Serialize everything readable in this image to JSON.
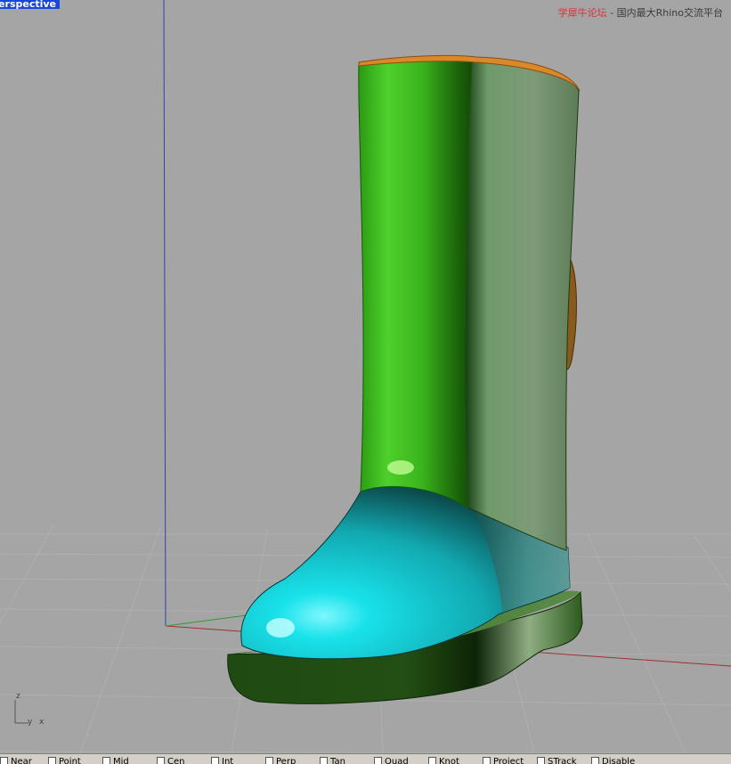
{
  "viewport": {
    "label": "Perspective",
    "watermark": {
      "primary": "学犀牛论坛",
      "separator": " - ",
      "secondary": "国内最大Rhino交流平台"
    },
    "axis_icon": {
      "z": "z",
      "y": "y",
      "x": "x"
    }
  },
  "colors": {
    "background": "#a5a5a5",
    "label_bg": "#1a46d8",
    "boot_shaft": "#3bb51c",
    "boot_toe": "#18c8cf",
    "boot_sole": "#1f4a12",
    "shaft_trim": "#c8781c"
  },
  "statusbar": {
    "snaps": [
      {
        "label": "Near"
      },
      {
        "label": "Point"
      },
      {
        "label": "Mid"
      },
      {
        "label": "Cen"
      },
      {
        "label": "Int"
      },
      {
        "label": "Perp"
      },
      {
        "label": "Tan"
      },
      {
        "label": "Quad"
      },
      {
        "label": "Knot"
      },
      {
        "label": "Project"
      },
      {
        "label": "STrack"
      },
      {
        "label": "Disable"
      }
    ]
  }
}
